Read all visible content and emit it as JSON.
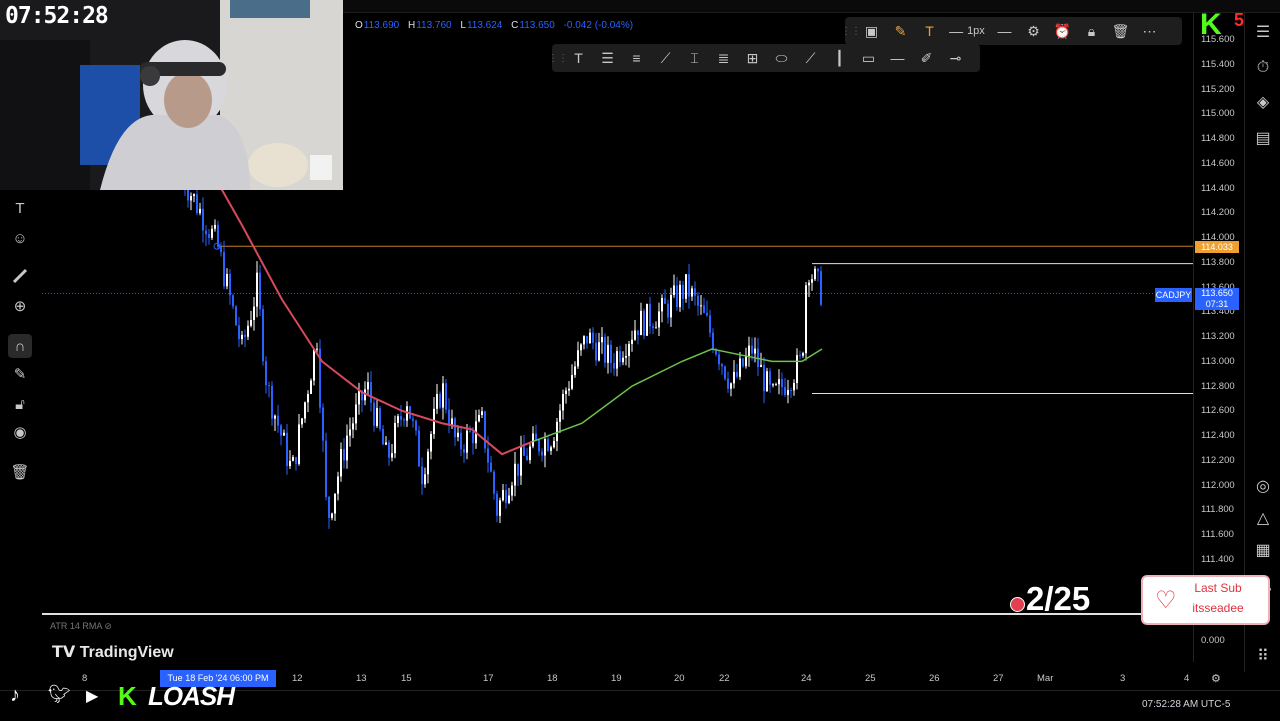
{
  "clock": "07:52:28",
  "ohlc": {
    "o_label": "O",
    "o": "113.690",
    "h_label": "H",
    "h": "113.760",
    "l_label": "L",
    "l": "113.624",
    "c_label": "C",
    "c": "113.650",
    "change": "-0.042 (-0.04%)"
  },
  "draw_toolbar": {
    "width_label": "1px"
  },
  "price_axis": [
    "115.600",
    "115.400",
    "115.200",
    "115.000",
    "114.800",
    "114.600",
    "114.400",
    "114.200",
    "114.000",
    "113.800",
    "113.600",
    "113.400",
    "113.200",
    "113.000",
    "112.800",
    "112.600",
    "112.400",
    "112.200",
    "112.000",
    "111.800",
    "111.600",
    "111.400"
  ],
  "price_badges": {
    "level": "114.033",
    "symbol": "CADJPY",
    "last": "113.650",
    "countdown": "07:31"
  },
  "indicator_zero": "0.000",
  "time_axis": [
    "8",
    "12",
    "13",
    "15",
    "17",
    "18",
    "19",
    "20",
    "22",
    "24",
    "25",
    "26",
    "27",
    "Mar",
    "3",
    "4"
  ],
  "current_date_label": "Tue 18 Feb '24  06:00 PM",
  "indicator_label": "ATR 14 RMA",
  "tv_brand": "TradingView",
  "timestamp": "07:52:28 AM UTC-5",
  "overlay": {
    "brand_k": "K",
    "brand_num": "5",
    "goal": "2/25",
    "sub_title": "Last Sub",
    "sub_name": "itsseadee",
    "streamer": "LOASH",
    "streamer_k": "K"
  },
  "colors": {
    "accent": "#2962ff",
    "candle_up": "#ffffff",
    "candle_down": "#2962ff",
    "ma_slow": "#d84a5a",
    "ma_fast": "#6cc24a",
    "level_orange": "#f0a030",
    "kick_green": "#53fc18"
  },
  "icons": [
    "text-icon",
    "emoji-icon",
    "ruler-icon",
    "zoom-icon",
    "magnet-icon",
    "lock-draw-icon",
    "lock-icon",
    "eye-icon",
    "trash-icon"
  ]
}
